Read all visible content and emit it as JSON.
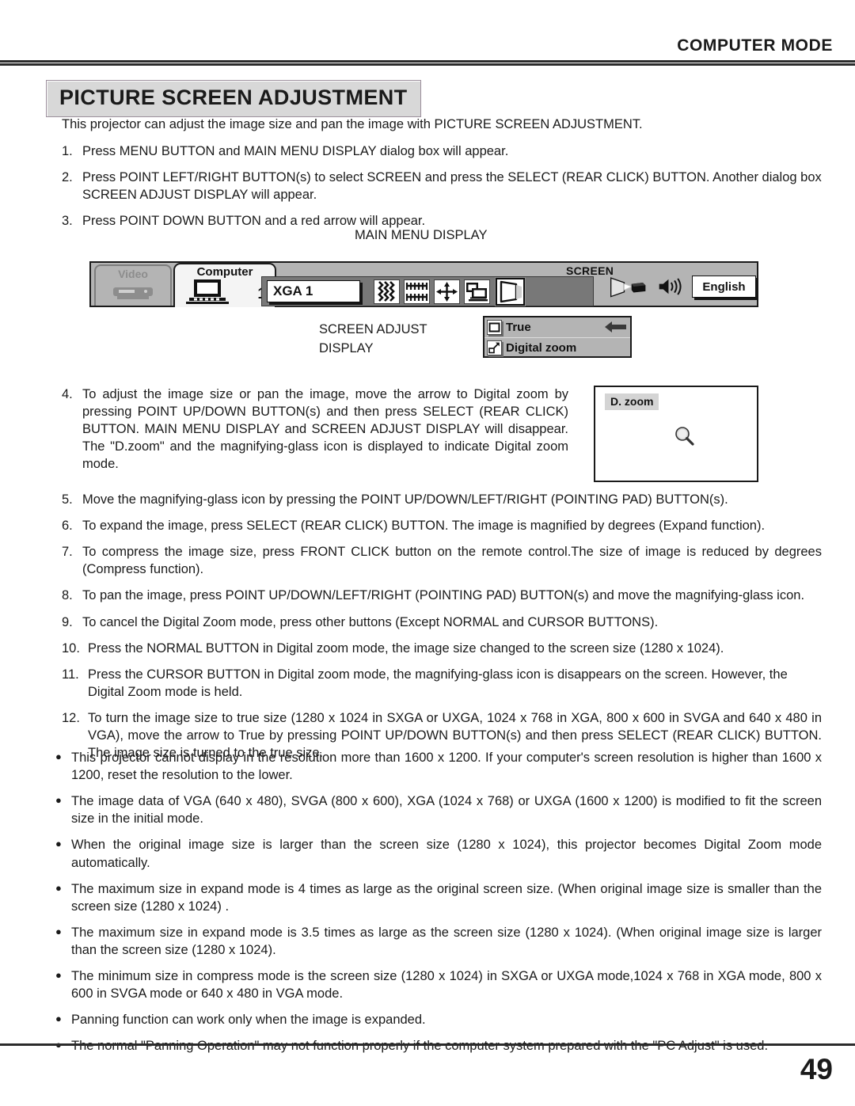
{
  "header": {
    "mode": "COMPUTER MODE",
    "title": "PICTURE SCREEN ADJUSTMENT"
  },
  "intro": "This projector can adjust the image size and pan the image with PICTURE SCREEN ADJUSTMENT.",
  "steps": [
    {
      "num": "1.",
      "text": "Press MENU BUTTON and MAIN MENU DISPLAY dialog box will appear."
    },
    {
      "num": "2.",
      "text": "Press POINT LEFT/RIGHT BUTTON(s) to select SCREEN and press the SELECT (REAR CLICK) BUTTON.  Another dialog box SCREEN ADJUST DISPLAY will appear."
    },
    {
      "num": "3.",
      "text": "Press POINT DOWN BUTTON and a red arrow will appear."
    },
    {
      "num": "4.",
      "text": "To adjust the image size or pan the image, move the arrow to Digital zoom by pressing POINT UP/DOWN BUTTON(s) and then press SELECT (REAR CLICK) BUTTON. MAIN MENU DISPLAY and SCREEN ADJUST DISPLAY will disappear. The \"D.zoom\" and the magnifying-glass icon is displayed to indicate Digital zoom mode."
    },
    {
      "num": "5.",
      "text": "Move the magnifying-glass icon by pressing the POINT UP/DOWN/LEFT/RIGHT (POINTING PAD) BUTTON(s)."
    },
    {
      "num": "6.",
      "text": "To expand the image, press SELECT (REAR CLICK) BUTTON. The image is magnified by degrees (Expand function)."
    },
    {
      "num": "7.",
      "text": "To compress the image size, press FRONT CLICK button on the remote control.The size of image is reduced by degrees (Compress function)."
    },
    {
      "num": "8.",
      "text": "To pan the image, press POINT UP/DOWN/LEFT/RIGHT (POINTING PAD) BUTTON(s) and move the magnifying-glass icon."
    },
    {
      "num": "9.",
      "text": "To cancel the Digital Zoom mode, press other buttons (Except NORMAL and CURSOR BUTTONS)."
    },
    {
      "num": "10.",
      "text": "Press the NORMAL BUTTON in Digital zoom mode, the image size changed to the screen size (1280  x 1024)."
    },
    {
      "num": "11.",
      "text": "Press the CURSOR BUTTON in Digital zoom mode, the magnifying-glass icon is disappears on the screen. However, the Digital Zoom mode is held."
    },
    {
      "num": "12.",
      "text": "To turn the image size to true size (1280 x 1024 in SXGA or UXGA, 1024 x 768 in XGA, 800 x 600 in SVGA and 640 x 480 in VGA), move the arrow to True by pressing POINT UP/DOWN BUTTON(s) and then press SELECT (REAR CLICK) BUTTON. The image size is turned to the true size."
    }
  ],
  "bullets": [
    "This projector cannot display in the resolution more than 1600 x 1200. If your computer's screen resolution is higher than 1600 x 1200, reset the resolution to the lower.",
    "The image data of VGA (640 x 480), SVGA (800 x 600), XGA (1024 x 768) or UXGA (1600 x 1200) is modified to fit the screen size in the initial mode.",
    "When the original image size is larger than the screen size (1280 x 1024), this projector becomes Digital Zoom mode automatically.",
    "The maximum size in expand mode is 4 times as large as the original screen size. (When original image size is smaller than the screen size (1280 x 1024) .",
    "The maximum size in expand mode is 3.5 times as large as the screen size (1280 x 1024). (When original image size is larger than the screen size (1280 x 1024).",
    "The minimum size in compress mode is the screen size (1280 x 1024) in SXGA or UXGA mode,1024 x 768 in XGA mode, 800 x 600 in SVGA mode or 640 x 480 in VGA mode.",
    "Panning function can work only when the image is expanded.",
    "The normal \"Panning Operation\" may not function properly if the computer system prepared with the \"PC Adjust\" is used."
  ],
  "main_menu": {
    "caption": "MAIN MENU DISPLAY",
    "tab_video": "Video",
    "tab_computer": "Computer",
    "computer_number": "1",
    "screen_label": "SCREEN",
    "mode_value": "XGA 1",
    "language_value": "English",
    "icons": [
      "fine-sync-icon",
      "total-dots-icon",
      "image-position-icon",
      "pc-adjust-icon",
      "screen-icon"
    ],
    "selected_icon": "screen-icon"
  },
  "screen_adjust": {
    "caption_line1": "SCREEN ADJUST",
    "caption_line2": "DISPLAY",
    "items": [
      {
        "label": "True",
        "icon": "true-size-icon",
        "arrow": true
      },
      {
        "label": "Digital zoom",
        "icon": "digital-zoom-icon",
        "arrow": false
      }
    ],
    "arrow_color": "#3a3a3a"
  },
  "dzoom_panel": {
    "tag": "D. zoom",
    "cursor_icon": "magnifying-glass-icon"
  },
  "footer": {
    "page_number": "49"
  }
}
